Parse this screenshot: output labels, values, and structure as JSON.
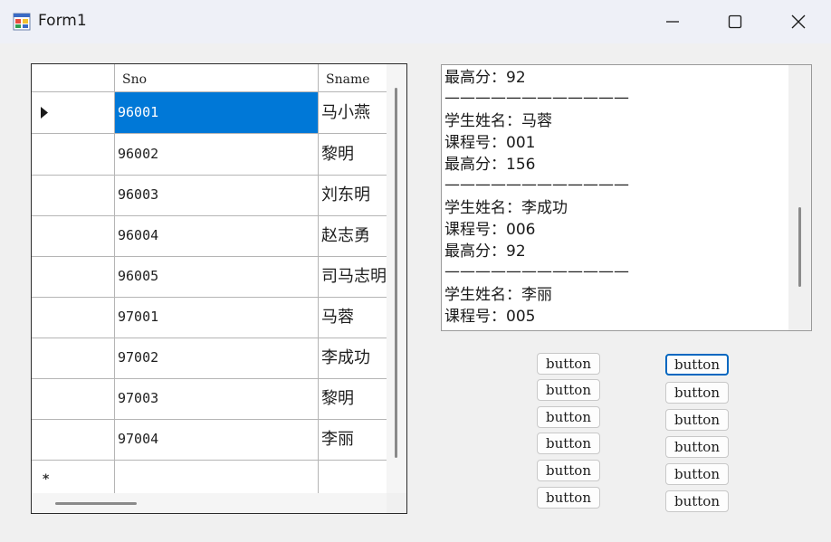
{
  "window": {
    "title": "Form1",
    "icon": "form-icon"
  },
  "grid": {
    "columns": [
      "Sno",
      "Sname"
    ],
    "rows": [
      {
        "sno": "96001",
        "sname": "马小燕"
      },
      {
        "sno": "96002",
        "sname": "黎明"
      },
      {
        "sno": "96003",
        "sname": "刘东明"
      },
      {
        "sno": "96004",
        "sname": "赵志勇"
      },
      {
        "sno": "96005",
        "sname": "司马志明"
      },
      {
        "sno": "97001",
        "sname": "马蓉"
      },
      {
        "sno": "97002",
        "sname": "李成功"
      },
      {
        "sno": "97003",
        "sname": "黎明"
      },
      {
        "sno": "97004",
        "sname": "李丽"
      }
    ],
    "selected_row": 0,
    "new_row_marker": "*"
  },
  "output": {
    "lines": [
      "最高分：92",
      "————————————",
      "学生姓名：马蓉",
      "课程号：001",
      "最高分：156",
      "————————————",
      "学生姓名：李成功",
      "课程号：006",
      "最高分：92",
      "————————————",
      "学生姓名：李丽",
      "课程号：005"
    ]
  },
  "buttons": {
    "left": [
      "button",
      "button",
      "button",
      "button",
      "button",
      "button"
    ],
    "right": [
      "button",
      "button",
      "button",
      "button",
      "button",
      "button"
    ]
  }
}
